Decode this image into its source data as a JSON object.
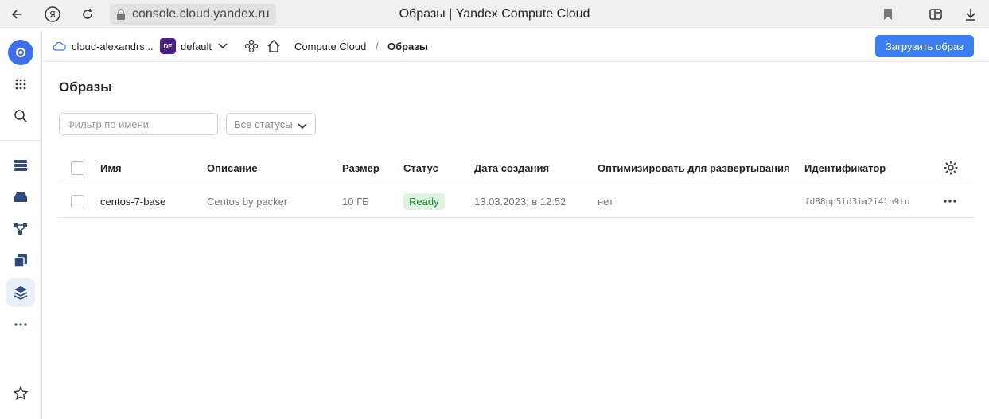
{
  "browser": {
    "url": "console.cloud.yandex.ru",
    "title": "Образы | Yandex Compute Cloud"
  },
  "rail": {
    "items": [
      "logo",
      "apps",
      "search",
      "services",
      "disks",
      "network",
      "snapshots",
      "images",
      "more",
      "favorites"
    ]
  },
  "header": {
    "cloud": "cloud-alexandrs...",
    "folder_badge": "DE",
    "folder": "default",
    "service": "Compute Cloud",
    "separator": "/",
    "current": "Образы",
    "upload_button": "Загрузить образ"
  },
  "page": {
    "title": "Образы",
    "filter_placeholder": "Фильтр по имени",
    "status_filter": "Все статусы"
  },
  "table": {
    "columns": [
      "Имя",
      "Описание",
      "Размер",
      "Статус",
      "Дата создания",
      "Оптимизировать для развертывания",
      "Идентификатор"
    ],
    "rows": [
      {
        "name": "centos-7-base",
        "description": "Centos by packer",
        "size": "10 ГБ",
        "status": "Ready",
        "created": "13.03.2023, в 12:52",
        "optimize": "нет",
        "id": "fd88pp5ld3im2i4ln9tu"
      }
    ]
  },
  "colors": {
    "accent": "#3a7ef2",
    "status_ready_bg": "#dff5e1",
    "status_ready_fg": "#1a8a2e"
  }
}
